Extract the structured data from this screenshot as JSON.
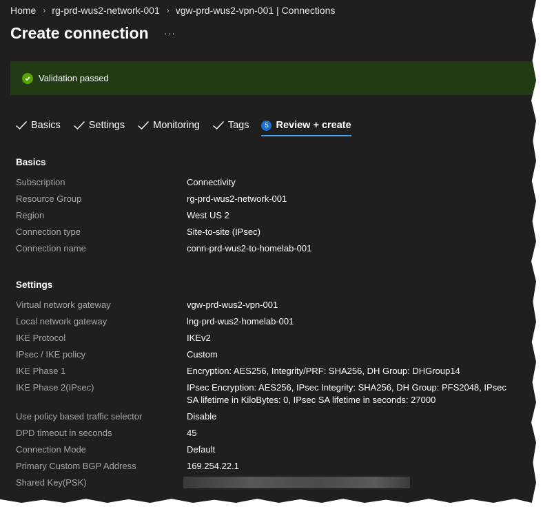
{
  "breadcrumb": [
    "Home",
    "rg-prd-wus2-network-001",
    "vgw-prd-wus2-vpn-001 | Connections"
  ],
  "page_title": "Create connection",
  "more_label": "···",
  "banner": {
    "text": "Validation passed",
    "color": "#57a300"
  },
  "tabs": [
    {
      "label": "Basics",
      "state": "done"
    },
    {
      "label": "Settings",
      "state": "done"
    },
    {
      "label": "Monitoring",
      "state": "done"
    },
    {
      "label": "Tags",
      "state": "done"
    },
    {
      "label": "Review + create",
      "state": "active",
      "step": "5"
    }
  ],
  "basics": {
    "title": "Basics",
    "rows": [
      {
        "label": "Subscription",
        "value": "Connectivity"
      },
      {
        "label": "Resource Group",
        "value": "rg-prd-wus2-network-001"
      },
      {
        "label": "Region",
        "value": "West US 2"
      },
      {
        "label": "Connection type",
        "value": "Site-to-site (IPsec)"
      },
      {
        "label": "Connection name",
        "value": "conn-prd-wus2-to-homelab-001"
      }
    ]
  },
  "settings": {
    "title": "Settings",
    "rows": [
      {
        "label": "Virtual network gateway",
        "value": "vgw-prd-wus2-vpn-001"
      },
      {
        "label": "Local network gateway",
        "value": "lng-prd-wus2-homelab-001"
      },
      {
        "label": "IKE Protocol",
        "value": "IKEv2"
      },
      {
        "label": "IPsec / IKE policy",
        "value": "Custom"
      },
      {
        "label": "IKE Phase 1",
        "value": "Encryption: AES256, Integrity/PRF: SHA256, DH Group: DHGroup14"
      },
      {
        "label": "IKE Phase 2(IPsec)",
        "value": "IPsec Encryption: AES256, IPsec Integrity: SHA256, DH Group: PFS2048, IPsec SA lifetime in KiloBytes: 0, IPsec SA lifetime in seconds: 27000"
      },
      {
        "label": "Use policy based traffic selector",
        "value": "Disable"
      },
      {
        "label": "DPD timeout in seconds",
        "value": "45"
      },
      {
        "label": "Connection Mode",
        "value": "Default"
      },
      {
        "label": "Primary Custom BGP Address",
        "value": "169.254.22.1"
      },
      {
        "label": "Shared Key(PSK)",
        "value": ""
      }
    ]
  }
}
